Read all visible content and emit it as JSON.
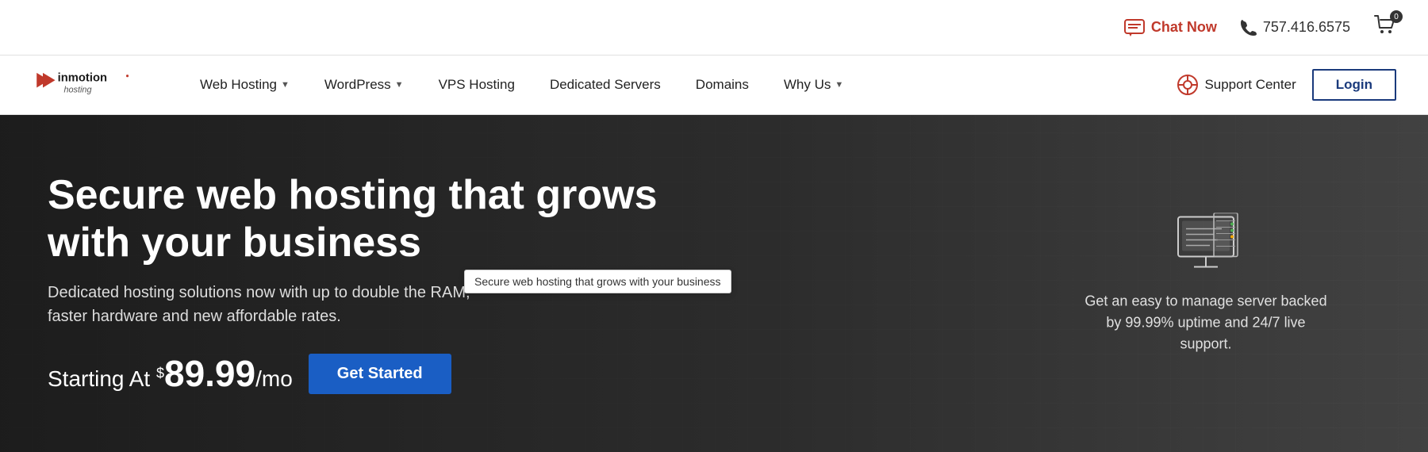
{
  "topbar": {
    "chat_label": "Chat Now",
    "phone": "757.416.6575",
    "cart_count": "0"
  },
  "nav": {
    "logo_text": "inmotion hosting",
    "items": [
      {
        "label": "Web Hosting",
        "has_dropdown": true
      },
      {
        "label": "WordPress",
        "has_dropdown": true
      },
      {
        "label": "VPS Hosting",
        "has_dropdown": false
      },
      {
        "label": "Dedicated Servers",
        "has_dropdown": false
      },
      {
        "label": "Domains",
        "has_dropdown": false
      },
      {
        "label": "Why Us",
        "has_dropdown": true
      }
    ],
    "support_label": "Support Center",
    "login_label": "Login"
  },
  "hero": {
    "title": "Secure web hosting that grows with your business",
    "subtitle": "Dedicated hosting solutions now with up to double the RAM, faster hardware and new affordable rates.",
    "starting_at": "Starting At",
    "currency": "$",
    "price": "89.99",
    "price_unit": "/mo",
    "cta_label": "Get Started",
    "tooltip_text": "Secure web hosting that grows with your business",
    "right_text": "Get an easy to manage server backed by 99.99% uptime and 24/7 live support."
  }
}
